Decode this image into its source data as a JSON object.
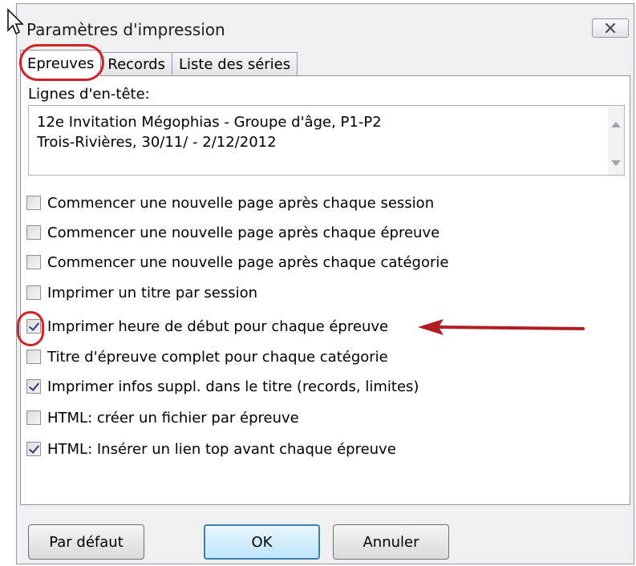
{
  "window": {
    "title": "Paramètres d'impression"
  },
  "tabs": [
    {
      "label": "Epreuves",
      "active": true
    },
    {
      "label": "Records",
      "active": false
    },
    {
      "label": "Liste des séries",
      "active": false
    }
  ],
  "header": {
    "label": "Lignes d'en-tête:",
    "lines": [
      "12e Invitation Mégophias - Groupe d'âge, P1-P2",
      "Trois-Rivières, 30/11/ - 2/12/2012"
    ]
  },
  "options": [
    {
      "label": "Commencer une nouvelle page après chaque session",
      "checked": false
    },
    {
      "label": "Commencer une nouvelle page après chaque épreuve",
      "checked": false
    },
    {
      "label": "Commencer une nouvelle page après chaque catégorie",
      "checked": false
    },
    {
      "label": "Imprimer un titre par session",
      "checked": false
    },
    {
      "label": "Imprimer heure de début pour chaque épreuve",
      "checked": true
    },
    {
      "label": "Titre d'épreuve complet pour chaque catégorie",
      "checked": false
    },
    {
      "label": "Imprimer infos suppl. dans le titre (records, limites)",
      "checked": true
    },
    {
      "label": "HTML: créer un fichier par épreuve",
      "checked": false
    },
    {
      "label": "HTML: Insérer un lien top avant chaque épreuve",
      "checked": true
    }
  ],
  "buttons": {
    "default_label": "Par défaut",
    "ok_label": "OK",
    "cancel_label": "Annuler"
  },
  "colors": {
    "annotation_red": "#d2232a",
    "arrow_red": "#b01e23"
  }
}
